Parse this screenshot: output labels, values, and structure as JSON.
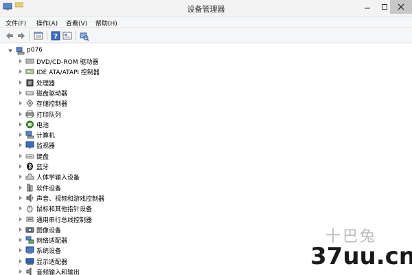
{
  "window": {
    "title": "设备管理器",
    "close_color": "#c7c7c7"
  },
  "menu": {
    "items": [
      {
        "label": "文件(F)"
      },
      {
        "label": "操作(A)"
      },
      {
        "label": "查看(V)"
      },
      {
        "label": "帮助(H)"
      }
    ]
  },
  "toolbar": {
    "buttons": [
      {
        "icon": "back-arrow-icon"
      },
      {
        "icon": "forward-arrow-icon"
      },
      {
        "icon": "properties-icon"
      },
      {
        "icon": "help-icon"
      },
      {
        "icon": "show-hidden-icon"
      },
      {
        "icon": "scan-hardware-icon"
      }
    ]
  },
  "tree": {
    "root": {
      "label": "p076",
      "icon": "computer-icon",
      "expanded": true
    },
    "items": [
      {
        "label": "DVD/CD-ROM 驱动器",
        "icon": "dvd-drive-icon"
      },
      {
        "label": "IDE ATA/ATAPI 控制器",
        "icon": "ide-controller-icon"
      },
      {
        "label": "处理器",
        "icon": "processor-icon"
      },
      {
        "label": "磁盘驱动器",
        "icon": "disk-drive-icon"
      },
      {
        "label": "存储控制器",
        "icon": "storage-controller-icon"
      },
      {
        "label": "打印队列",
        "icon": "printer-icon"
      },
      {
        "label": "电池",
        "icon": "battery-icon"
      },
      {
        "label": "计算机",
        "icon": "computer-icon"
      },
      {
        "label": "监视器",
        "icon": "monitor-icon"
      },
      {
        "label": "键盘",
        "icon": "keyboard-icon"
      },
      {
        "label": "蓝牙",
        "icon": "bluetooth-icon"
      },
      {
        "label": "人体学输入设备",
        "icon": "hid-icon"
      },
      {
        "label": "软件设备",
        "icon": "software-device-icon"
      },
      {
        "label": "声音、视频和游戏控制器",
        "icon": "sound-icon"
      },
      {
        "label": "鼠标和其他指针设备",
        "icon": "mouse-icon"
      },
      {
        "label": "通用串行总线控制器",
        "icon": "usb-controller-icon"
      },
      {
        "label": "图像设备",
        "icon": "imaging-device-icon"
      },
      {
        "label": "网络适配器",
        "icon": "network-adapter-icon"
      },
      {
        "label": "系统设备",
        "icon": "system-device-icon"
      },
      {
        "label": "显示适配器",
        "icon": "display-adapter-icon"
      },
      {
        "label": "音频输入和输出",
        "icon": "audio-io-icon"
      }
    ]
  },
  "watermark": {
    "text": "37uu.cn",
    "logo": "十巴兔"
  }
}
